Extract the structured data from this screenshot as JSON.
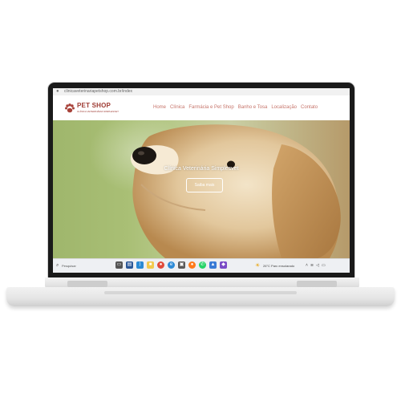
{
  "browser": {
    "url": "clinicaveterinariapetshop.com.br/index"
  },
  "header": {
    "logo_icon": "paw-icon",
    "logo_title": "PET SHOP",
    "logo_subtitle": "CLÍNICA VETERINÁRIA SIMPLESVET",
    "nav": [
      "Home",
      "Clínica",
      "Farmácia e Pet Shop",
      "Banho e Tosa",
      "Localização",
      "Contato"
    ]
  },
  "hero": {
    "title": "Clínica Veterinária Simplesvet",
    "button_label": "Saiba mais"
  },
  "taskbar": {
    "search_label": "Pesquisar",
    "weather_text": "26°C  Parc ensolarado",
    "tray_icons": [
      "chevron-up-icon",
      "wifi-icon",
      "volume-icon",
      "battery-icon"
    ],
    "app_icons": [
      "task-view-icon",
      "explorer-icon",
      "vscode-icon",
      "file-manager-icon",
      "chrome-icon",
      "edge-icon",
      "store-icon",
      "firefox-icon",
      "whatsapp-icon",
      "photos-icon",
      "app-icon"
    ]
  },
  "colors": {
    "brand": "#9e3b33",
    "nav": "#c6746a"
  }
}
